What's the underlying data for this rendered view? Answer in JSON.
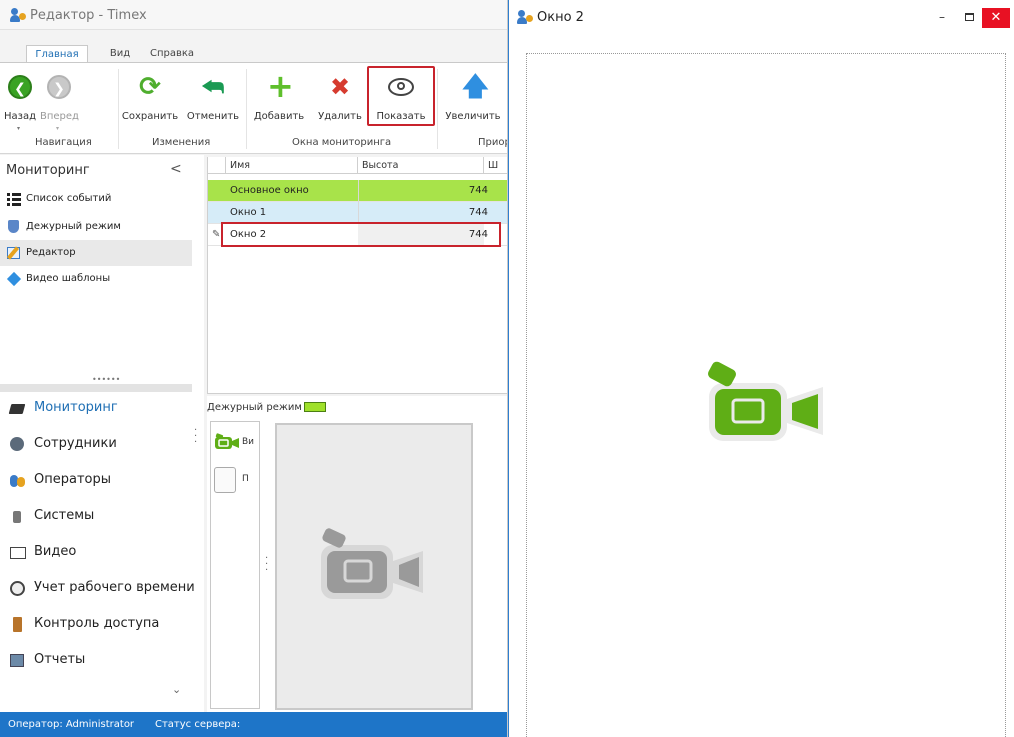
{
  "main_window": {
    "title": "Редактор - Timex",
    "tabs": [
      "Главная",
      "Вид",
      "Справка"
    ],
    "ribbon": {
      "buttons": {
        "back": "Назад",
        "forward": "Вперед",
        "save": "Сохранить",
        "cancel": "Отменить",
        "add": "Добавить",
        "delete": "Удалить",
        "show": "Показать",
        "enlarge": "Увеличить"
      },
      "groups": {
        "navigation": "Навигация",
        "changes": "Изменения",
        "monitor_windows": "Окна мониторинга",
        "priority": "Приор"
      }
    },
    "nav_panel": {
      "header": "Мониторинг",
      "collapse": "<",
      "items": [
        "Список событий",
        "Дежурный режим",
        "Редактор",
        "Видео шаблоны"
      ],
      "selected": "Редактор"
    },
    "bottom_nav": [
      "Мониторинг",
      "Сотрудники",
      "Операторы",
      "Системы",
      "Видео",
      "Учет рабочего времени",
      "Контроль доступа",
      "Отчеты"
    ],
    "more": "⌄",
    "grid": {
      "columns": [
        "Имя",
        "Высота",
        "Ш"
      ],
      "rows": [
        {
          "name": "Основное окно",
          "height": "744"
        },
        {
          "name": "Окно 1",
          "height": "744"
        },
        {
          "name": "Окно 2",
          "height": "744"
        }
      ]
    },
    "duty": {
      "label": "Дежурный режим",
      "color": "#9fe02a",
      "templates": [
        "Ви",
        "П"
      ]
    },
    "status_bar": {
      "operator": "Оператор: Administrator",
      "server": "Статус сервера:"
    }
  },
  "window2": {
    "title": "Окно 2",
    "controls": {
      "minimize": "–",
      "close": "✕"
    }
  },
  "colors": {
    "accent": "#1e75c8",
    "highlight": "#c8232c",
    "main_row": "#a8e34a",
    "selected_row": "#d6ecf8",
    "camera_green": "#5fae16"
  }
}
